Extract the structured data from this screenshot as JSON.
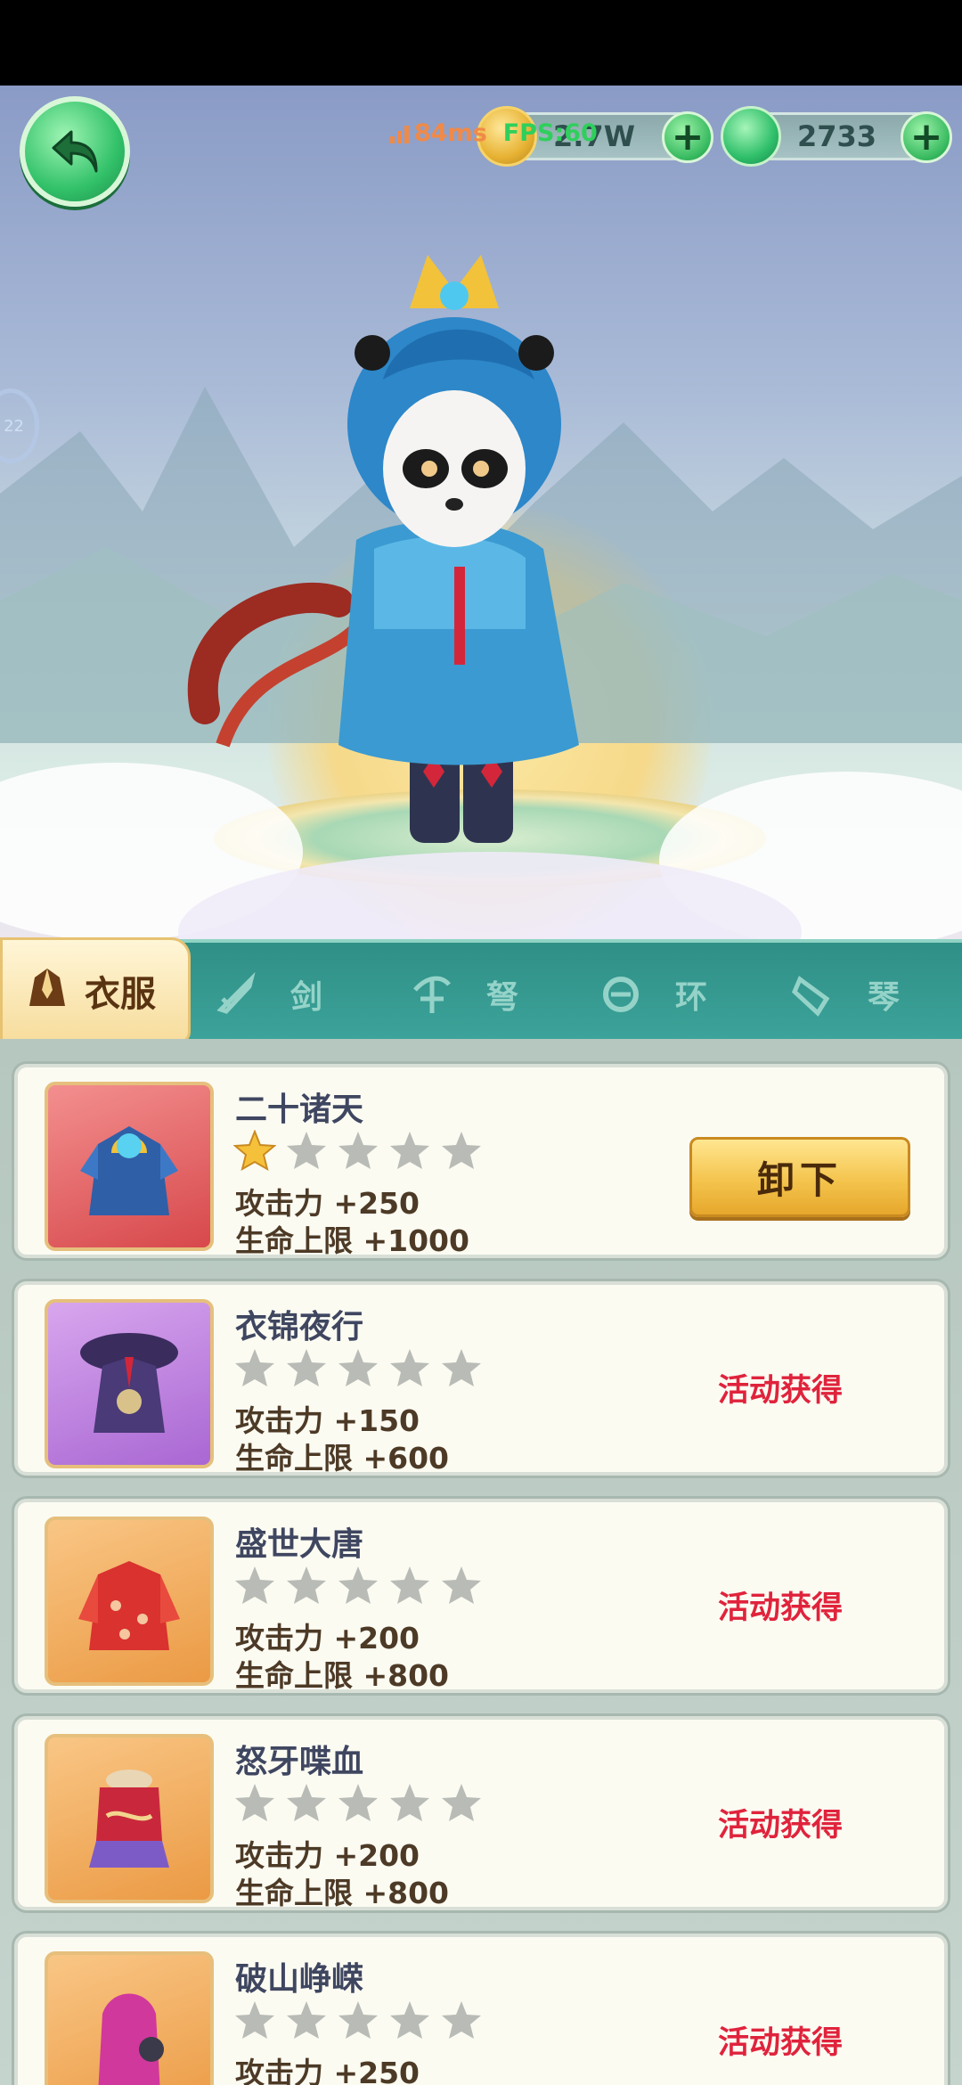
{
  "hud": {
    "ping": "84ms",
    "fps": "FPS:60",
    "gold": "2.7W",
    "jade": "2733",
    "side_tab": "22"
  },
  "tabs": [
    {
      "label": "衣服",
      "icon": "robe-icon",
      "active": true
    },
    {
      "label": "剑",
      "icon": "sword-icon",
      "active": false
    },
    {
      "label": "弩",
      "icon": "crossbow-icon",
      "active": false
    },
    {
      "label": "环",
      "icon": "ring-icon",
      "active": false
    },
    {
      "label": "琴",
      "icon": "zither-icon",
      "active": false
    }
  ],
  "items": [
    {
      "name": "二十诸天",
      "stars": 1,
      "stat1": "攻击力 +250",
      "stat2": "生命上限 +1000",
      "action": "卸下",
      "thumb_icon": "blue-robe-icon",
      "frame": "red"
    },
    {
      "name": "衣锦夜行",
      "stars": 0,
      "stat1": "攻击力 +150",
      "stat2": "生命上限 +600",
      "action": "活动获得",
      "thumb_icon": "purple-robe-icon",
      "frame": "purple"
    },
    {
      "name": "盛世大唐",
      "stars": 0,
      "stat1": "攻击力 +200",
      "stat2": "生命上限 +800",
      "action": "活动获得",
      "thumb_icon": "red-dress-icon",
      "frame": "orange"
    },
    {
      "name": "怒牙喋血",
      "stars": 0,
      "stat1": "攻击力 +200",
      "stat2": "生命上限 +800",
      "action": "活动获得",
      "thumb_icon": "red-armor-icon",
      "frame": "orange"
    },
    {
      "name": "破山峥嵘",
      "stars": 0,
      "stat1": "攻击力 +250",
      "stat2": "",
      "action": "活动获得",
      "thumb_icon": "pink-robe-icon",
      "frame": "orange"
    }
  ],
  "colors": {
    "obtain_text": "#e0233c",
    "star_filled": "#f6c13a",
    "star_empty": "#b9bcb6",
    "tab_bar": "#2f8f86"
  }
}
